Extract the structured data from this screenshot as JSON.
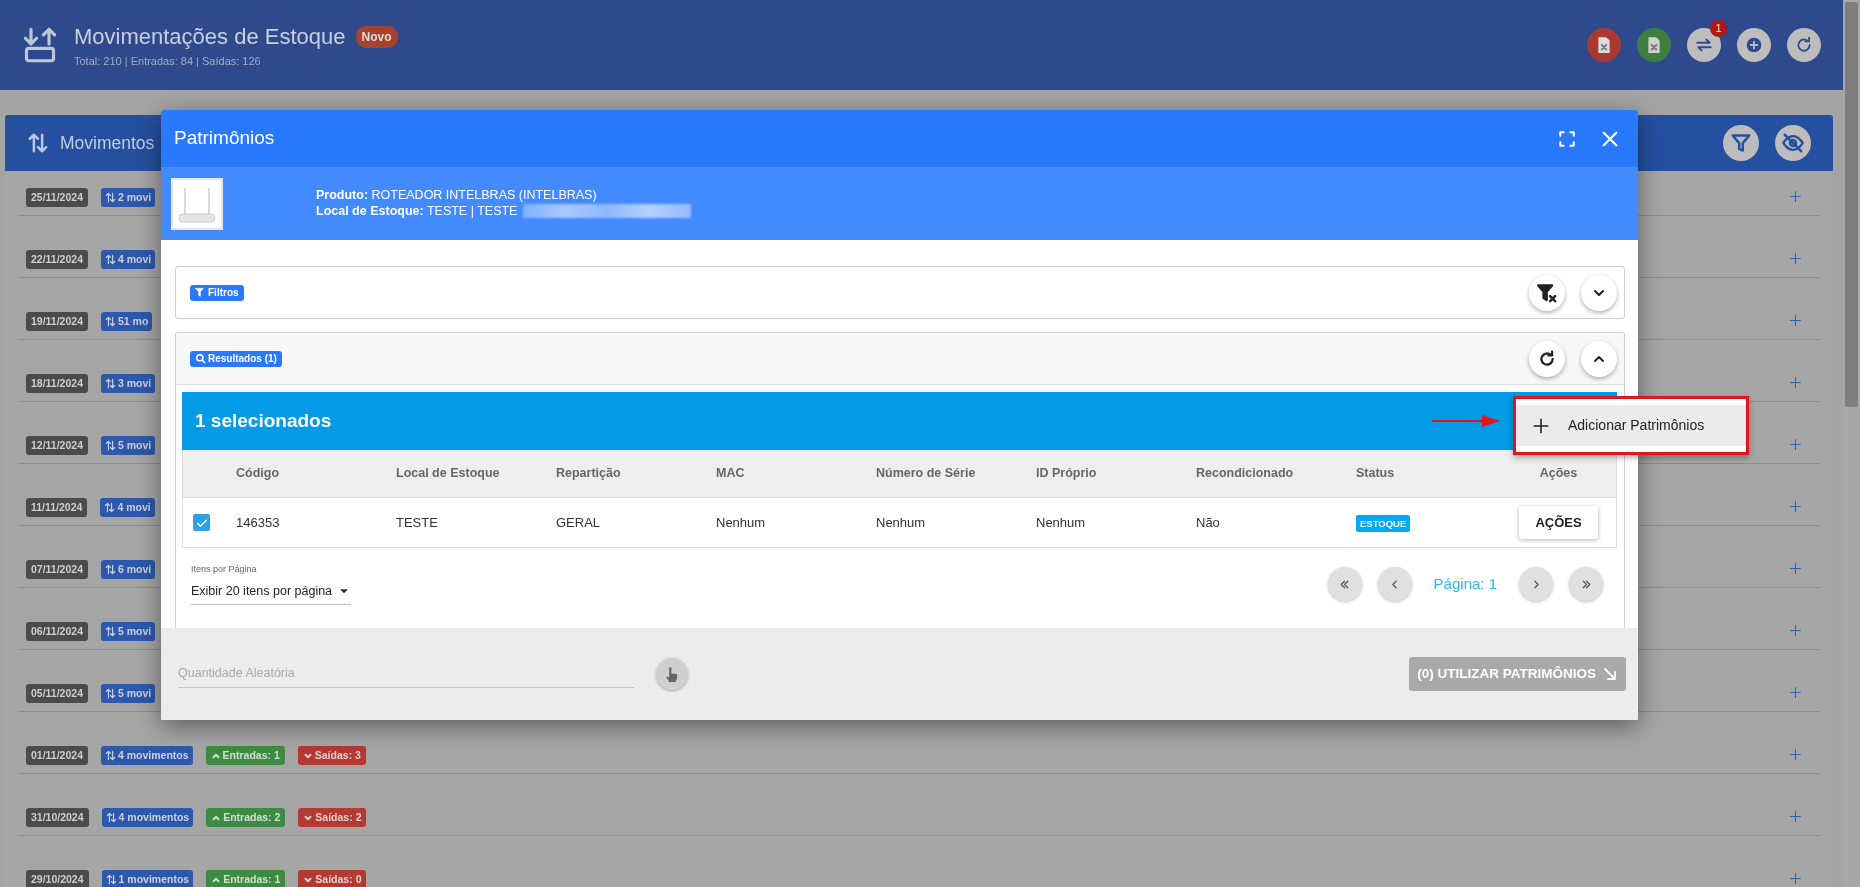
{
  "header": {
    "title": "Movimentações de Estoque",
    "badge": "Novo",
    "summary": "Total: 210 | Entradas: 84 | Saídas: 126",
    "actions": [
      {
        "kind": "pdf"
      },
      {
        "kind": "excel"
      },
      {
        "kind": "transfer",
        "count": "1"
      },
      {
        "kind": "add"
      },
      {
        "kind": "refresh"
      }
    ]
  },
  "movements": {
    "title": "Movimentos",
    "tools": [
      {
        "kind": "filter"
      },
      {
        "kind": "hide"
      }
    ],
    "rows": [
      {
        "date": "25/11/2024",
        "moves": "2 movi"
      },
      {
        "date": "22/11/2024",
        "moves": "4 movi"
      },
      {
        "date": "19/11/2024",
        "moves": "51 mo"
      },
      {
        "date": "18/11/2024",
        "moves": "3 movi"
      },
      {
        "date": "12/11/2024",
        "moves": "5 movi"
      },
      {
        "date": "11/11/2024",
        "moves": "4 movi"
      },
      {
        "date": "07/11/2024",
        "moves": "6 movi"
      },
      {
        "date": "06/11/2024",
        "moves": "5 movi"
      },
      {
        "date": "05/11/2024",
        "moves": "5 movi"
      },
      {
        "date": "01/11/2024",
        "moves": "4 movimentos",
        "entries": "Entradas: 1",
        "exits": "Saídas: 3"
      },
      {
        "date": "31/10/2024",
        "moves": "4 movimentos",
        "entries": "Entradas: 2",
        "exits": "Saídas: 2"
      },
      {
        "date": "29/10/2024",
        "moves": "1 movimentos",
        "entries": "Entradas: 1",
        "exits": "Saídas: 0"
      }
    ]
  },
  "modal": {
    "title": "Patrimônios",
    "product_lines": [
      "**Produto:** ROTEADOR INTELBRAS (INTELBRAS)",
      "**Local de Estoque:** TESTE | TESTE"
    ],
    "filters": {
      "label": "Filtros"
    },
    "results": {
      "label": "Resultados (1)",
      "selection": "1 selecionados",
      "columns": [
        "Código",
        "Local de Estoque",
        "Repartição",
        "MAC",
        "Número de Série",
        "ID Próprio",
        "Recondicionado",
        "Status",
        "Ações"
      ],
      "rows": [
        {
          "selected": true,
          "cells": [
            "146353",
            "TESTE",
            "GERAL",
            "Nenhum",
            "Nenhum",
            "Nenhum",
            "Não"
          ],
          "status": "ESTOQUE",
          "action": "AÇÕES"
        }
      ],
      "page_size": {
        "label": "Itens por Página",
        "value": "Exibir 20 itens por página"
      },
      "page": "Página: 1"
    },
    "footer": {
      "placeholder": "Quantidade Aleatória",
      "submit": {
        "label": "(0) UTILIZAR PATRIMÔNIOS",
        "disabled": true
      }
    }
  },
  "menu": {
    "items": [
      {
        "label": "Adicionar Patrimônios"
      }
    ]
  }
}
